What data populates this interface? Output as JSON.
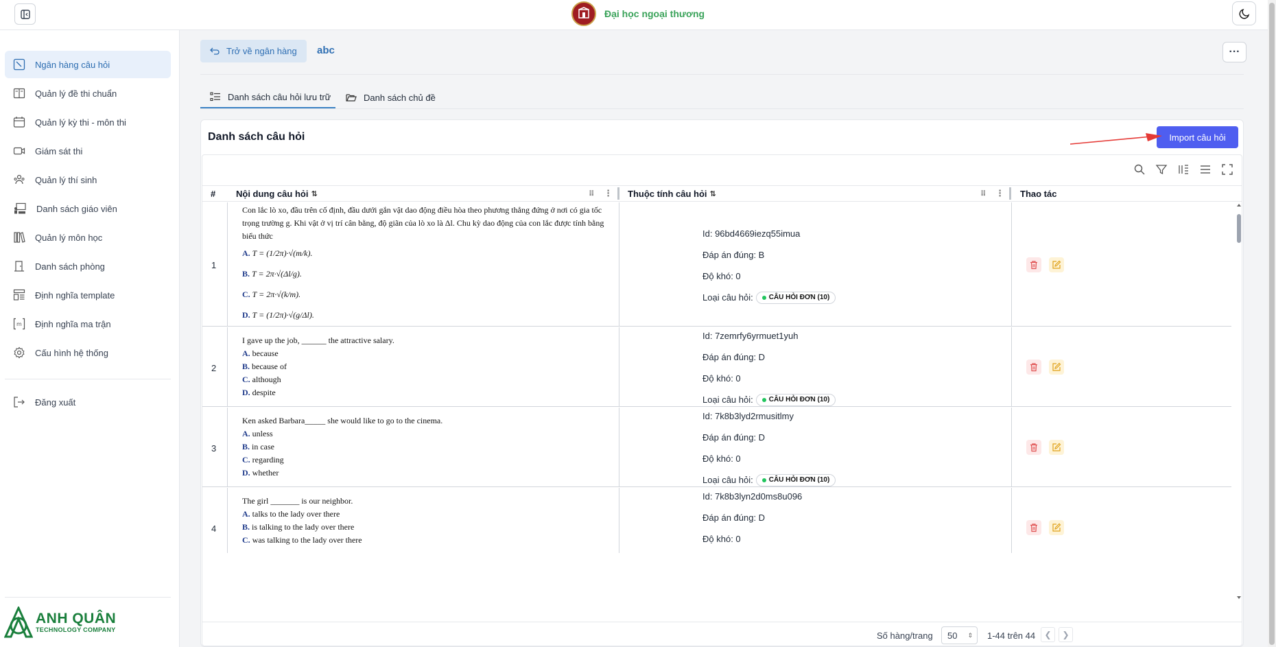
{
  "header": {
    "brand_name": "Đại học ngoại thương"
  },
  "sidebar": {
    "items": [
      {
        "label": "Ngân hàng câu hỏi"
      },
      {
        "label": "Quản lý đề thi chuẩn"
      },
      {
        "label": "Quản lý kỳ thi - môn thi"
      },
      {
        "label": "Giám sát thi"
      },
      {
        "label": "Quản lý thí sinh"
      },
      {
        "label": "Danh sách giáo viên"
      },
      {
        "label": "Quản lý môn học"
      },
      {
        "label": "Danh sách phòng"
      },
      {
        "label": "Định nghĩa template"
      },
      {
        "label": "Định nghĩa ma trận"
      },
      {
        "label": "Cấu hình hệ thống"
      }
    ],
    "logout_label": "Đăng xuất",
    "company": {
      "name": "ANH QUÂN",
      "tagline": "TECHNOLOGY COMPANY"
    }
  },
  "main": {
    "back_label": "Trở về ngân hàng",
    "bank_name": "abc",
    "more_label": "···",
    "tabs": [
      {
        "label": "Danh sách câu hỏi lưu trữ"
      },
      {
        "label": "Danh sách chủ đề"
      }
    ]
  },
  "card": {
    "title": "Danh sách câu hỏi",
    "import_label": "Import câu hỏi"
  },
  "table": {
    "headers": {
      "num": "#",
      "content": "Nội dung câu hỏi",
      "props": "Thuộc tính câu hỏi",
      "actions": "Thao tác"
    },
    "rows": [
      {
        "num": "1",
        "stem": "Con lắc lò xo, đầu trên cố định, đầu dưới gắn vật dao động điều hòa theo phương thẳng đứng ở nơi có gia tốc trọng trường g. Khi vật ở vị trí cân bằng, độ giãn của lò xo là Δl. Chu kỳ dao động của con lắc được tính bằng biểu thức",
        "options": [
          {
            "key": "A.",
            "text": "T = (1/2π)·√(m/k)."
          },
          {
            "key": "B.",
            "text": "T = 2π·√(Δl/g)."
          },
          {
            "key": "C.",
            "text": "T = 2π·√(k/m)."
          },
          {
            "key": "D.",
            "text": "T = (1/2π)·√(g/Δl)."
          }
        ],
        "id": "Id: 96bd4669iezq55imua",
        "answer": "Đáp án đúng: B",
        "difficulty": "Độ khó: 0",
        "type_label": "Loại câu hỏi:",
        "type": "CÂU HỎI ĐƠN (10)"
      },
      {
        "num": "2",
        "stem": "I gave up the job, ______ the attractive salary.",
        "options": [
          {
            "key": "A.",
            "text": "because"
          },
          {
            "key": "B.",
            "text": "because of"
          },
          {
            "key": "C.",
            "text": "although"
          },
          {
            "key": "D.",
            "text": "despite"
          }
        ],
        "id": "Id: 7zemrfy6yrmuet1yuh",
        "answer": "Đáp án đúng: D",
        "difficulty": "Độ khó: 0",
        "type_label": "Loại câu hỏi:",
        "type": "CÂU HỎI ĐƠN (10)"
      },
      {
        "num": "3",
        "stem": "Ken asked Barbara_____ she would like to go to the cinema.",
        "options": [
          {
            "key": "A.",
            "text": "unless"
          },
          {
            "key": "B.",
            "text": "in case"
          },
          {
            "key": "C.",
            "text": "regarding"
          },
          {
            "key": "D.",
            "text": "whether"
          }
        ],
        "id": "Id: 7k8b3lyd2rmusitlmy",
        "answer": "Đáp án đúng: D",
        "difficulty": "Độ khó: 0",
        "type_label": "Loại câu hỏi:",
        "type": "CÂU HỎI ĐƠN (10)"
      },
      {
        "num": "4",
        "stem": "The girl _______ is our neighbor.",
        "options": [
          {
            "key": "A.",
            "text": "talks to the lady over there"
          },
          {
            "key": "B.",
            "text": "is talking to the lady over there"
          },
          {
            "key": "C.",
            "text": "was talking to the lady over there"
          }
        ],
        "id": "Id: 7k8b3lyn2d0ms8u096",
        "answer": "Đáp án đúng: D",
        "difficulty": "Độ khó: 0"
      }
    ]
  },
  "pagination": {
    "rows_label": "Số hàng/trang",
    "rows_value": "50",
    "range": "1-44 trên 44"
  }
}
